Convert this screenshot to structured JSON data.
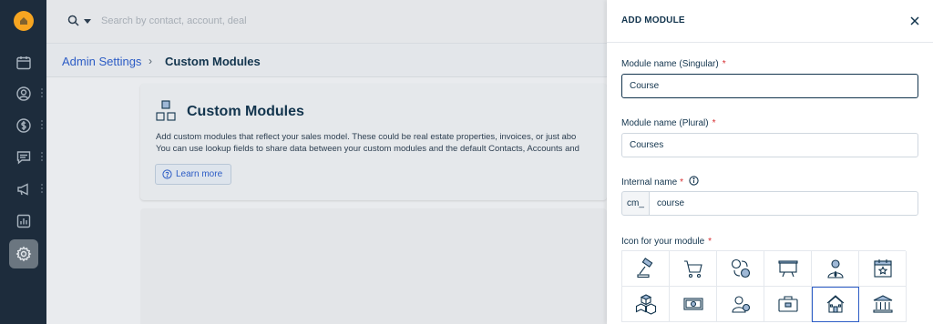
{
  "topbar": {
    "search_placeholder": "Search by contact, account, deal"
  },
  "breadcrumb": {
    "parent": "Admin Settings",
    "separator": "›",
    "current": "Custom Modules"
  },
  "card": {
    "title": "Custom Modules",
    "desc_line1": "Add custom modules that reflect your sales model. These could be real estate properties, invoices, or just abo",
    "desc_line2": "You can use lookup fields to share data between your custom modules and the default Contacts, Accounts and",
    "learn_more": "Learn more"
  },
  "panel": {
    "title": "ADD MODULE",
    "singular_label": "Module name (Singular)",
    "singular_value": "Course",
    "plural_label": "Module name (Plural)",
    "plural_value": "Courses",
    "internal_label": "Internal name",
    "internal_prefix": "cm_",
    "internal_value": "course",
    "icon_label": "Icon for your module",
    "required_mark": "*",
    "icons": [
      "gavel-icon",
      "cart-icon",
      "exchange-icon",
      "presentation-icon",
      "person-tie-icon",
      "calendar-star-icon",
      "boxes-icon",
      "money-icon",
      "person-icon",
      "briefcase-icon",
      "house-icon",
      "bank-icon"
    ],
    "selected_icon": "house-icon"
  },
  "colors": {
    "accent": "#2c5cc5",
    "nav_bg": "#1d2c3c",
    "required": "#d72d30",
    "logo": "#f6a521"
  }
}
